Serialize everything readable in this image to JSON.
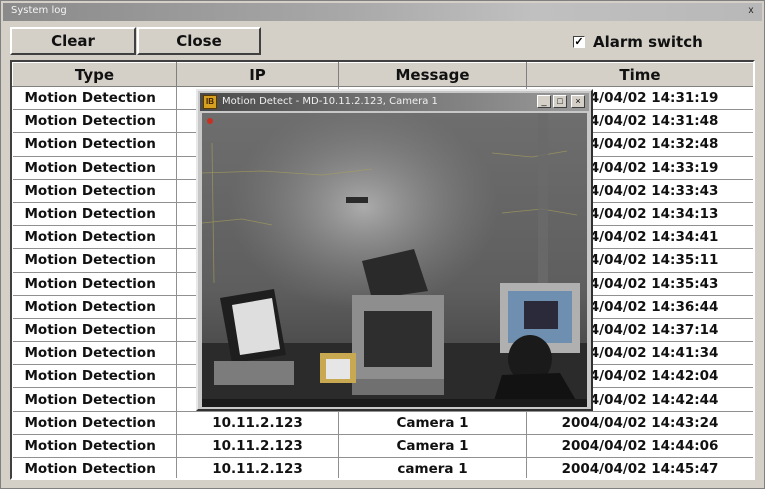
{
  "window": {
    "title": "System log",
    "close_glyph": "x"
  },
  "toolbar": {
    "clear_label": "Clear",
    "close_label": "Close"
  },
  "alarm": {
    "checked": true,
    "check_glyph": "✓",
    "label": "Alarm switch"
  },
  "table": {
    "columns": [
      "Type",
      "IP",
      "Message",
      "Time"
    ],
    "rows": [
      {
        "type": "Motion Detection",
        "ip": "",
        "message": "",
        "time": "2004/04/02 14:31:19"
      },
      {
        "type": "Motion Detection",
        "ip": "",
        "message": "",
        "time": "2004/04/02 14:31:48"
      },
      {
        "type": "Motion Detection",
        "ip": "",
        "message": "",
        "time": "2004/04/02 14:32:48"
      },
      {
        "type": "Motion Detection",
        "ip": "",
        "message": "",
        "time": "2004/04/02 14:33:19"
      },
      {
        "type": "Motion Detection",
        "ip": "",
        "message": "",
        "time": "2004/04/02 14:33:43"
      },
      {
        "type": "Motion Detection",
        "ip": "",
        "message": "",
        "time": "2004/04/02 14:34:13"
      },
      {
        "type": "Motion Detection",
        "ip": "",
        "message": "",
        "time": "2004/04/02 14:34:41"
      },
      {
        "type": "Motion Detection",
        "ip": "",
        "message": "",
        "time": "2004/04/02 14:35:11"
      },
      {
        "type": "Motion Detection",
        "ip": "",
        "message": "",
        "time": "2004/04/02 14:35:43"
      },
      {
        "type": "Motion Detection",
        "ip": "",
        "message": "",
        "time": "2004/04/02 14:36:44"
      },
      {
        "type": "Motion Detection",
        "ip": "",
        "message": "",
        "time": "2004/04/02 14:37:14"
      },
      {
        "type": "Motion Detection",
        "ip": "",
        "message": "",
        "time": "2004/04/02 14:41:34"
      },
      {
        "type": "Motion Detection",
        "ip": "",
        "message": "",
        "time": "2004/04/02 14:42:04"
      },
      {
        "type": "Motion Detection",
        "ip": "",
        "message": "",
        "time": "2004/04/02 14:42:44"
      },
      {
        "type": "Motion Detection",
        "ip": "10.11.2.123",
        "message": "Camera 1",
        "time": "2004/04/02 14:43:24"
      },
      {
        "type": "Motion Detection",
        "ip": "10.11.2.123",
        "message": "Camera 1",
        "time": "2004/04/02 14:44:06"
      },
      {
        "type": "Motion Detection",
        "ip": "10.11.2.123",
        "message": "camera 1",
        "time": "2004/04/02 14:45:47"
      }
    ]
  },
  "camera_window": {
    "title": "Motion Detect - MD-10.11.2.123, Camera 1",
    "app_icon": "camera-app-icon",
    "minimize_glyph": "_",
    "maximize_glyph": "□",
    "close_glyph": "×"
  },
  "colors": {
    "window_bg": "#d4d0c8",
    "grid_bg": "#ffffff",
    "text": "#111111"
  }
}
